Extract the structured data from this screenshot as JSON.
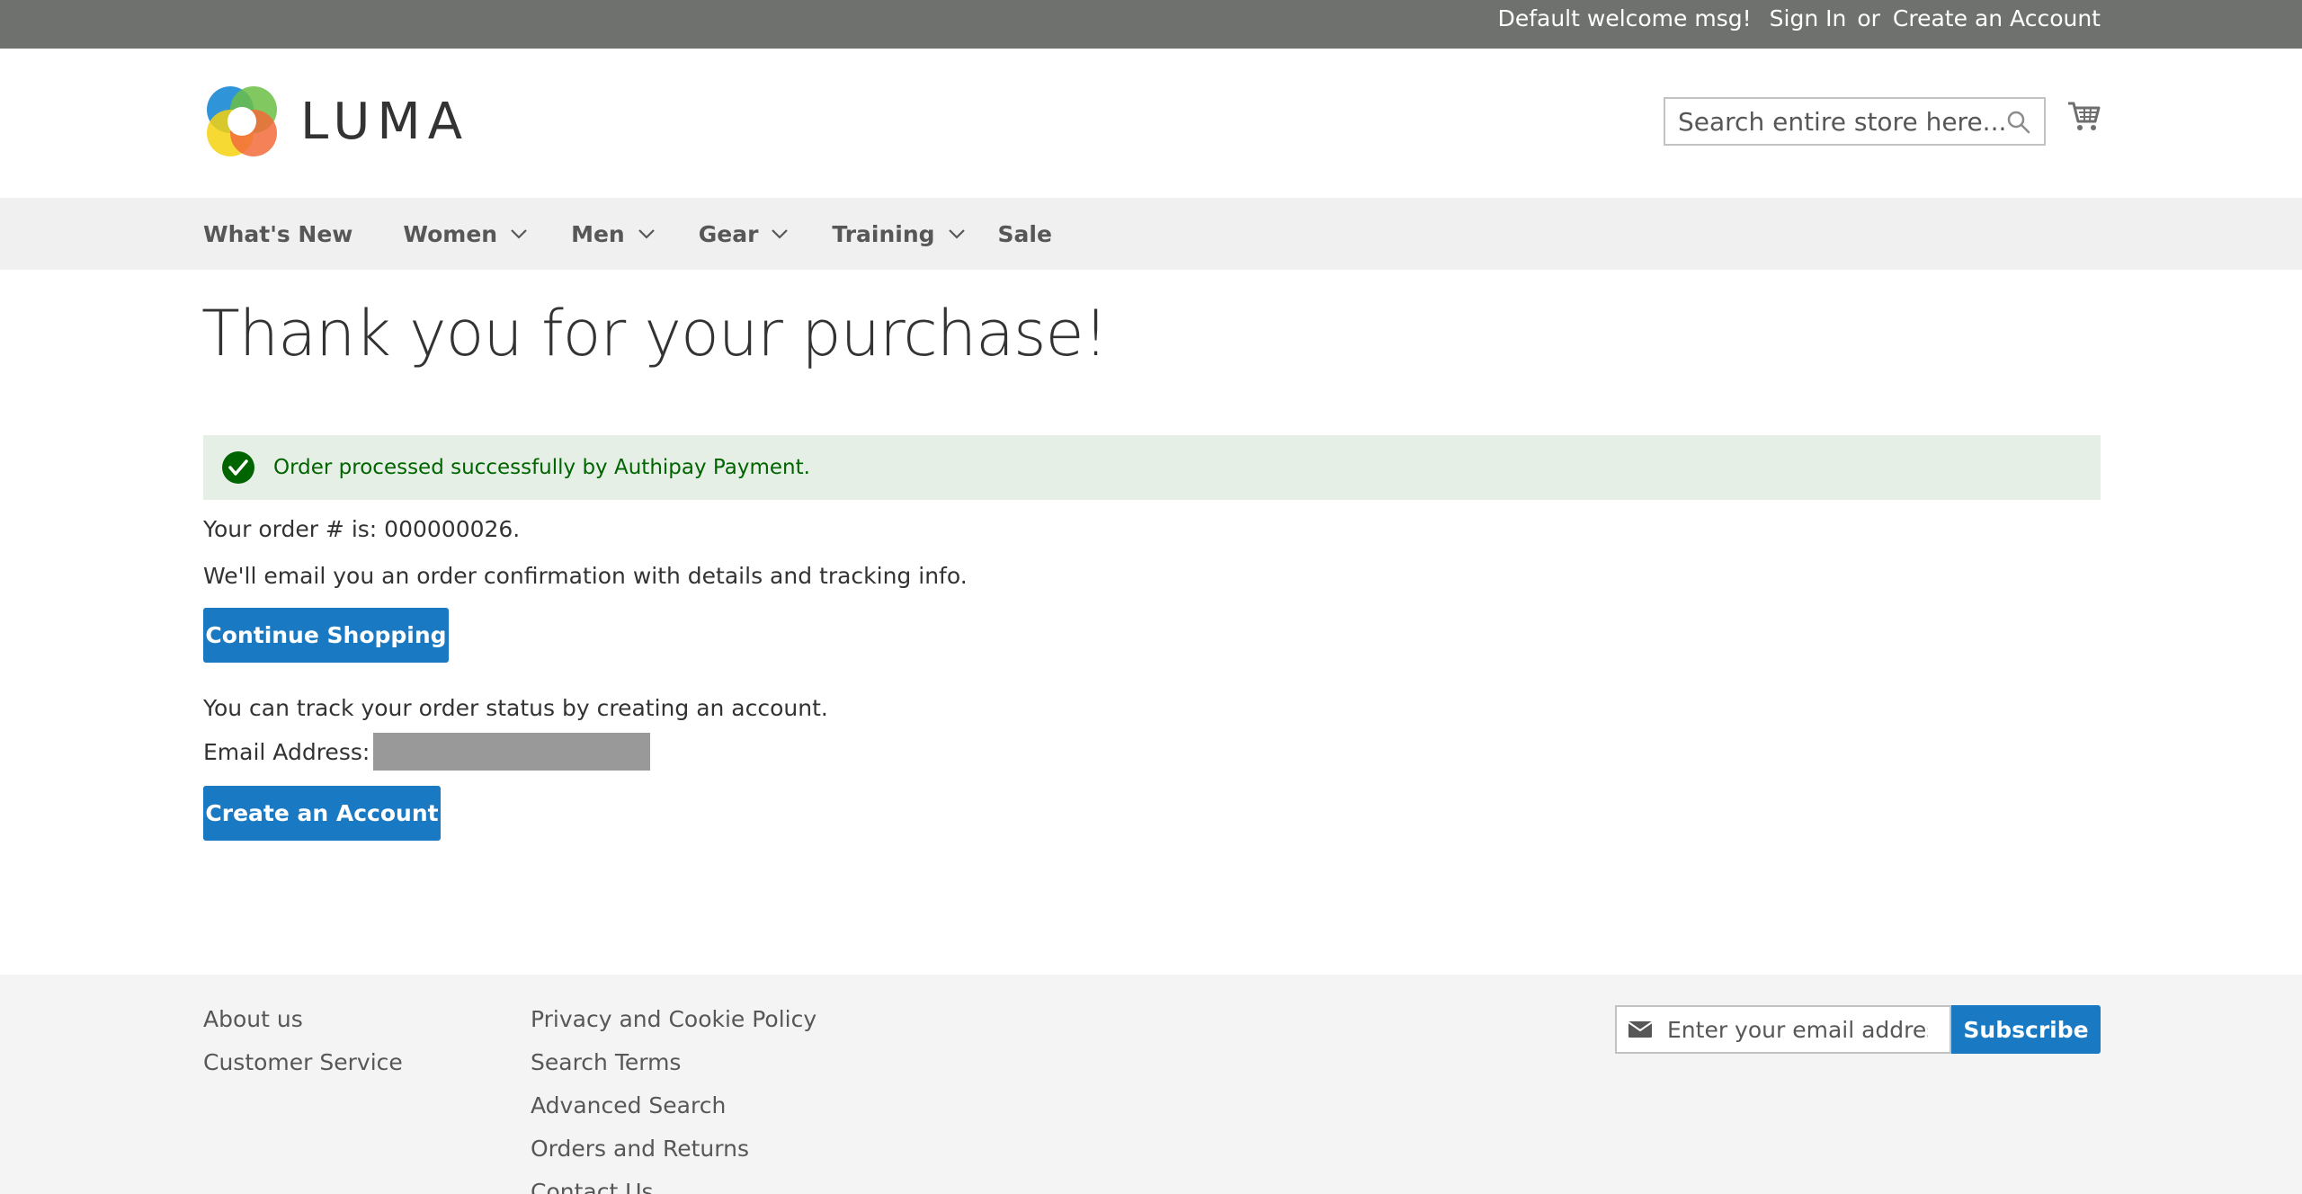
{
  "topbar": {
    "welcome": "Default welcome msg!",
    "sign_in": "Sign In",
    "or": "or",
    "create_account": "Create an Account"
  },
  "header": {
    "logo_text": "LUMA",
    "search_placeholder": "Search entire store here...",
    "cart_icon": "cart-icon"
  },
  "nav": {
    "items": [
      {
        "label": "What's New",
        "has_dropdown": false
      },
      {
        "label": "Women",
        "has_dropdown": true
      },
      {
        "label": "Men",
        "has_dropdown": true
      },
      {
        "label": "Gear",
        "has_dropdown": true
      },
      {
        "label": "Training",
        "has_dropdown": true
      },
      {
        "label": "Sale",
        "has_dropdown": false
      }
    ]
  },
  "main": {
    "title": "Thank you for your purchase!",
    "message": "Order processed successfully by Authipay Payment.",
    "order_line": "Your order # is: 000000026.",
    "email_line": "We'll email you an order confirmation with details and tracking info.",
    "continue_button": "Continue Shopping",
    "track_line": "You can track your order status by creating an account.",
    "email_label": "Email Address:",
    "create_button": "Create an Account"
  },
  "footer": {
    "col1": [
      "About us",
      "Customer Service"
    ],
    "col2": [
      "Privacy and Cookie Policy",
      "Search Terms",
      "Advanced Search",
      "Orders and Returns",
      "Contact Us"
    ],
    "newsletter_placeholder": "Enter your email address",
    "subscribe_button": "Subscribe"
  },
  "colors": {
    "topbar": "#6e716e",
    "accent": "#1979c3",
    "success_bg": "#e5efe5",
    "success_text": "#006400",
    "nav_bg": "#f0f0f0",
    "footer_bg": "#f4f4f4"
  }
}
